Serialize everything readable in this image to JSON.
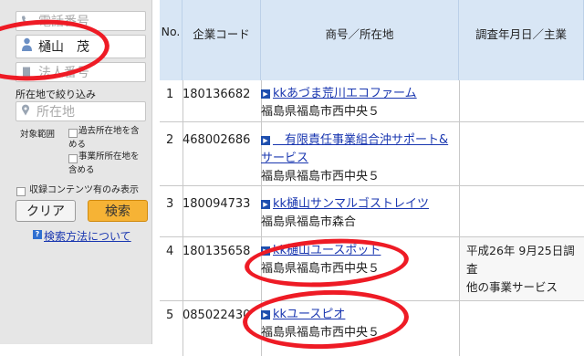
{
  "sidebar": {
    "phone_placeholder": "電話番号",
    "name_value": "樋山　茂",
    "corp_placeholder": "法人番号",
    "filter_label": "所在地で絞り込み",
    "location_placeholder": "所在地",
    "scope_label": "対象範囲",
    "checkbox1_line1": "過去所在地を含",
    "checkbox1_line2": "める",
    "checkbox2_line1": "事業所所在地を",
    "checkbox2_line2": "含める",
    "checkbox3": "収録コンテンツ有のみ表示",
    "clear_label": "クリア",
    "search_label": "検索",
    "help_label": "検索方法について"
  },
  "table": {
    "headers": {
      "no": "No.",
      "code": "企業コード",
      "name": "商号／所在地",
      "survey": "調査年月日／主業"
    },
    "rows": [
      {
        "no": "1",
        "code": "180136682",
        "name": "kkあづま荒川エコファーム",
        "address": "福島県福島市西中央５",
        "survey_date": "",
        "business": ""
      },
      {
        "no": "2",
        "code": "468002686",
        "name": "　有限責任事業組合沖サポート&サービス",
        "address": "福島県福島市西中央５",
        "survey_date": "",
        "business": ""
      },
      {
        "no": "3",
        "code": "180094733",
        "name": "kk樋山サンマルゴストレイツ",
        "address": "福島県福島市森合",
        "survey_date": "",
        "business": ""
      },
      {
        "no": "4",
        "code": "180135658",
        "name": "kk樋山ユースポット",
        "address": "福島県福島市西中央５",
        "survey_date": "平成26年 9月25日調査",
        "business": "他の事業サービス"
      },
      {
        "no": "5",
        "code": "085022430",
        "name": "kkユースピオ",
        "address": "福島県福島市西中央５",
        "survey_date": "",
        "business": ""
      }
    ]
  },
  "colors": {
    "header_bg": "#d8e6f5",
    "link": "#1a37b0",
    "search_button": "#f6b335",
    "annotation": "#ee1b25"
  }
}
